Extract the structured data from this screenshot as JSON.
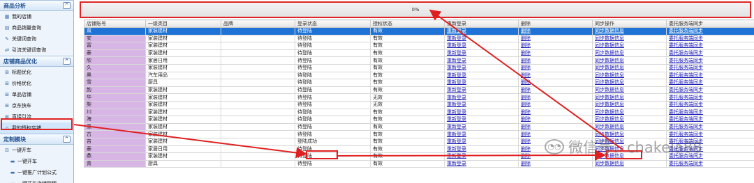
{
  "sidebar": {
    "sections": [
      {
        "title": "商品分析",
        "toggle": "^",
        "items": [
          "我的店铺",
          "商品销量查询",
          "关键词查询",
          "引流关键词查询"
        ]
      },
      {
        "title": "店铺商品优化",
        "toggle": "^",
        "items": [
          "标题优化",
          "价格优化",
          "单品店铺",
          "京东快车",
          "直接引流",
          "我的授权店铺"
        ]
      },
      {
        "title": "定制模块",
        "toggle": "^",
        "items": [
          "一键开车",
          "一键开车",
          "一键推广计划公式",
          "一键开车店铺管理"
        ]
      }
    ]
  },
  "progress": {
    "text": "0%"
  },
  "table": {
    "headers": [
      "店铺账号",
      "一级类目",
      "品牌",
      "登录状态",
      "授权状态",
      "重新登录",
      "删除",
      "同步操作",
      "委托服务端同步"
    ],
    "rows": [
      [
        "双",
        "家装建材",
        "",
        "待登陆",
        "有效",
        "重新登录",
        "删除",
        "同步数据信息",
        "委托服务端同步"
      ],
      [
        "安",
        "家装建材",
        "",
        "待登陆",
        "有效",
        "重新登录",
        "删除",
        "同步数据信息",
        "委托服务端同步"
      ],
      [
        "富",
        "家装建材",
        "",
        "待登陆",
        "有效",
        "重新登录",
        "删除",
        "同步数据信息",
        "委托服务端同步"
      ],
      [
        "泰",
        "家装建材",
        "",
        "待登陆",
        "有效",
        "重新登录",
        "删除",
        "同步数据信息",
        "委托服务端同步"
      ],
      [
        "欣",
        "家居日用",
        "",
        "待登陆",
        "有效",
        "重新登录",
        "删除",
        "同步数据信息",
        "委托服务端同步"
      ],
      [
        "久",
        "家装建材",
        "",
        "待登陆",
        "有效",
        "重新登录",
        "删除",
        "同步数据信息",
        "委托服务端同步"
      ],
      [
        "黑",
        "汽车用品",
        "",
        "待登陆",
        "有效",
        "重新登录",
        "删除",
        "同步数据信息",
        "委托服务端同步"
      ],
      [
        "雪",
        "厨具",
        "",
        "待登陆",
        "有效",
        "重新登录",
        "删除",
        "同步数据信息",
        "委托服务端同步"
      ],
      [
        "韵",
        "家装建材",
        "",
        "待登陆",
        "有效",
        "重新登录",
        "删除",
        "同步数据信息",
        "委托服务端同步"
      ],
      [
        "华",
        "家装建材",
        "",
        "待登陆",
        "无效",
        "重新登录",
        "删除",
        "同步数据信息",
        "委托服务端同步"
      ],
      [
        "梨",
        "家装建材",
        "",
        "待登陆",
        "无效",
        "重新登录",
        "删除",
        "同步数据信息",
        "委托服务端同步"
      ],
      [
        "川",
        "家装建材",
        "",
        "待登陆",
        "有效",
        "重新登录",
        "删除",
        "同步数据信息",
        "委托服务端同步"
      ],
      [
        "海",
        "家装建材",
        "",
        "待登陆",
        "有效",
        "重新登录",
        "删除",
        "同步数据信息",
        "委托服务端同步"
      ],
      [
        "重",
        "家装建材",
        "",
        "待登陆",
        "有效",
        "重新登录",
        "删除",
        "同步数据信息",
        "委托服务端同步"
      ],
      [
        "古",
        "家装建材",
        "",
        "待登陆",
        "有效",
        "重新登录",
        "删除",
        "同步数据信息",
        "委托服务端同步"
      ],
      [
        "吉",
        "家装建材",
        "",
        "登陆成功",
        "有效",
        "重新登录",
        "删除",
        "同步数据信息",
        "委托服务端同步"
      ],
      [
        "泰",
        "家居日用",
        "",
        "待登陆",
        "有效",
        "重新登录",
        "删除",
        "同步数据信息",
        "委托服务端同步"
      ],
      [
        "鼎",
        "家装建材",
        "",
        "待登陆",
        "有效",
        "重新登录",
        "删除",
        "同步数据信息",
        "委托服务端同步"
      ],
      [
        "青",
        "厨具",
        "",
        "待登陆",
        "有效",
        "重新登录",
        "删除",
        "同步数据信息",
        "委托服务端同步"
      ]
    ],
    "selected_row": 0
  },
  "watermark": {
    "icon": "wechat-icon",
    "text": "微信号：chakela88"
  },
  "colors": {
    "annotation": "#e02020",
    "selected": "#1f73d6",
    "purple_cell": "#d7b6e6",
    "link": "#1a1ab8"
  }
}
